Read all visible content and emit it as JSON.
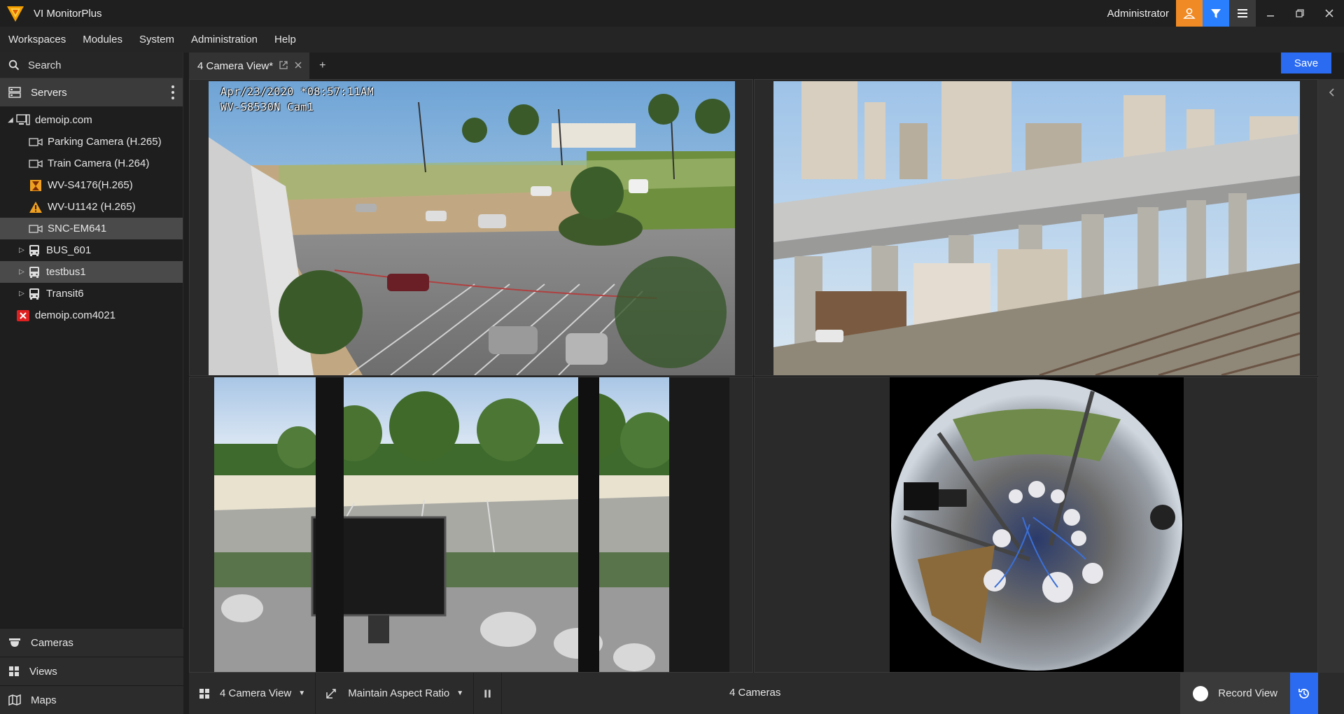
{
  "app": {
    "title": "VI MonitorPlus",
    "user": "Administrator"
  },
  "menu": {
    "items": [
      "Workspaces",
      "Modules",
      "System",
      "Administration",
      "Help"
    ]
  },
  "sidebar": {
    "search_label": "Search",
    "servers_label": "Servers",
    "tree": [
      {
        "label": "demoip.com",
        "type": "server"
      },
      {
        "label": "Parking Camera (H.265)",
        "type": "camera"
      },
      {
        "label": "Train Camera (H.264)",
        "type": "camera"
      },
      {
        "label": "WV-S4176(H.265)",
        "type": "camera-warning"
      },
      {
        "label": "WV-U1142 (H.265)",
        "type": "camera-warning"
      },
      {
        "label": "SNC-EM641",
        "type": "camera",
        "selected": true
      },
      {
        "label": "BUS_601",
        "type": "bus"
      },
      {
        "label": "testbus1",
        "type": "bus",
        "selected": true
      },
      {
        "label": "Transit6",
        "type": "bus"
      },
      {
        "label": "demoip.com4021",
        "type": "server-error"
      }
    ],
    "bottom_nav": [
      "Cameras",
      "Views",
      "Maps"
    ]
  },
  "tabs": {
    "active_label": "4 Camera View*",
    "add_label": "+",
    "save_label": "Save"
  },
  "feeds": {
    "cam1_timestamp": "Apr/23/2020 *08:57:11AM",
    "cam1_name": "WV-S8530N Cam1"
  },
  "toolbar": {
    "layout_label": "4 Camera View",
    "aspect_label": "Maintain Aspect Ratio",
    "camera_count": "4 Cameras",
    "record_label": "Record View"
  },
  "colors": {
    "accent_blue": "#2a6bf2",
    "accent_orange": "#f08a24",
    "warning": "#f0a020",
    "error": "#e02020"
  }
}
